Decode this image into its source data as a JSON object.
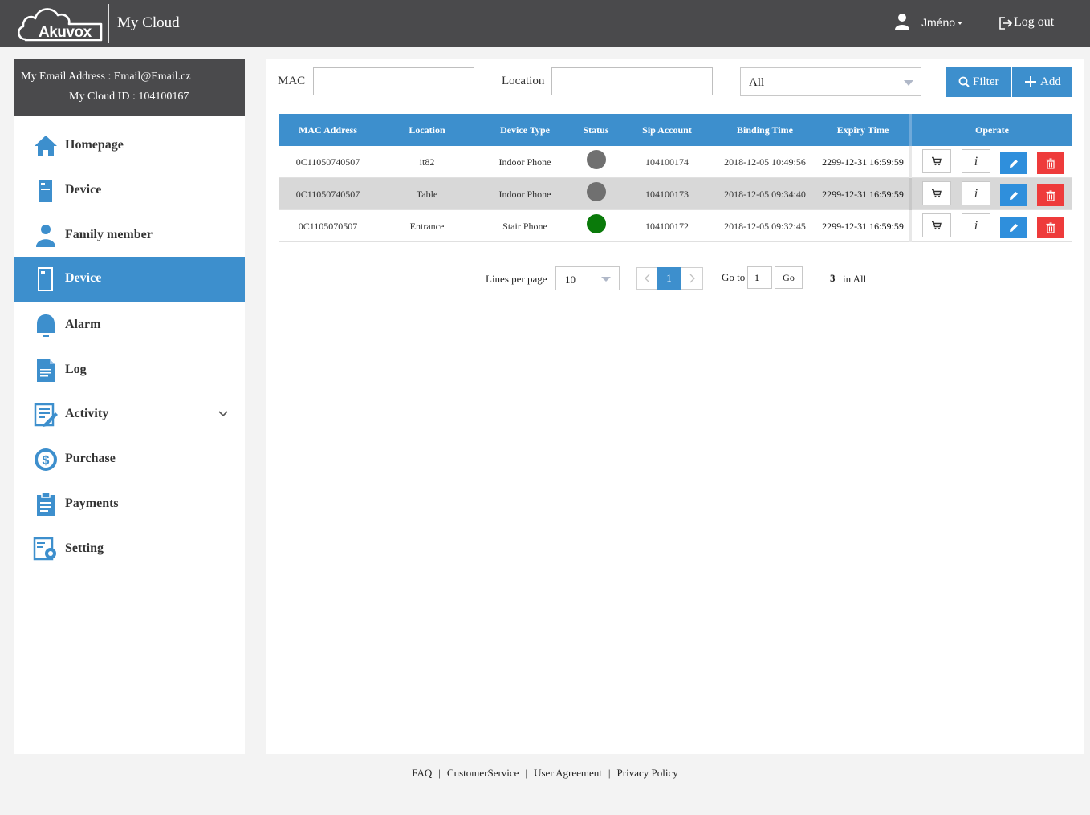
{
  "header": {
    "logo_text": "Akuvox",
    "app_title": "My Cloud",
    "user_name": "Jméno",
    "logout_label": "Log out"
  },
  "account": {
    "email_line": "My Email Address : Email@Email.cz",
    "id_line": "My Cloud ID : 104100167"
  },
  "sidebar": {
    "items": [
      {
        "label": "Homepage",
        "icon": "home-icon"
      },
      {
        "label": "Device",
        "icon": "device-icon"
      },
      {
        "label": "Family member",
        "icon": "person-icon"
      },
      {
        "label": "Device",
        "icon": "device-icon",
        "active": true
      },
      {
        "label": "Alarm",
        "icon": "bell-icon"
      },
      {
        "label": "Log",
        "icon": "document-icon"
      },
      {
        "label": "Activity",
        "icon": "activity-edit-icon",
        "expandable": true
      },
      {
        "label": "Purchase",
        "icon": "dollar-coin-icon"
      },
      {
        "label": "Payments",
        "icon": "clipboard-icon"
      },
      {
        "label": "Setting",
        "icon": "settings-gear-icon"
      }
    ]
  },
  "filters": {
    "mac_label": "MAC",
    "mac_value": "",
    "location_label": "Location",
    "location_value": "",
    "status_select": "All",
    "filter_button": "Filter",
    "add_button": "Add"
  },
  "table": {
    "columns": [
      "MAC Address",
      "Location",
      "Device Type",
      "Status",
      "Sip Account",
      "Binding Time",
      "Expiry Time",
      "Operate"
    ],
    "rows": [
      {
        "mac": "0C11050740507",
        "location": "it82",
        "device_type": "Indoor Phone",
        "status": "offline",
        "sip": "104100174",
        "binding": "2018-12-05 10:49:56",
        "expiry": "2299-12-31 16:59:59"
      },
      {
        "mac": "0C11050740507",
        "location": "Table",
        "device_type": "Indoor Phone",
        "status": "offline",
        "sip": "104100173",
        "binding": "2018-12-05 09:34:40",
        "expiry": "2299-12-31 16:59:59"
      },
      {
        "mac": "0C1105070507",
        "location": "Entrance",
        "device_type": "Stair Phone",
        "status": "online",
        "sip": "104100172",
        "binding": "2018-12-05 09:32:45",
        "expiry": "2299-12-31 16:59:59"
      }
    ],
    "info_label": "i"
  },
  "pagination": {
    "lines_label": "Lines per page",
    "lines_value": "10",
    "current_page": "1",
    "goto_label": "Go to",
    "goto_value": "1",
    "go_button": "Go",
    "total_count": "3",
    "total_suffix": "in All"
  },
  "footer": {
    "links": [
      "FAQ",
      "CustomerService",
      "User Agreement",
      "Privacy Policy"
    ],
    "separator": "|"
  },
  "colors": {
    "header_bg": "#4a4a4c",
    "accent": "#3d8fcd",
    "danger": "#ee3b3b",
    "status_offline": "#707070",
    "status_online": "#0a7a0a"
  }
}
